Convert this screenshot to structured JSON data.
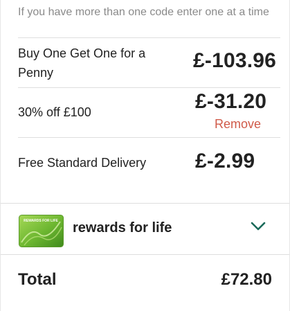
{
  "promo": {
    "hint": "If you have more than one code enter one at a time"
  },
  "discounts": [
    {
      "label": "Buy One Get One for a Penny",
      "amount": "£-103.96"
    },
    {
      "label": "30% off £100",
      "amount": "£-31.20",
      "remove_label": "Remove"
    },
    {
      "label": "Free Standard Delivery",
      "amount": "£-2.99"
    }
  ],
  "rewards": {
    "label": "rewards for life",
    "card_text": "REWARDS FOR LIFE",
    "chevron_icon": "chevron-down-icon"
  },
  "total": {
    "label": "Total",
    "amount": "£72.80"
  },
  "colors": {
    "remove_link": "#d05a49",
    "chevron": "#1a6a5a",
    "card_green": "#7bbf3a"
  }
}
